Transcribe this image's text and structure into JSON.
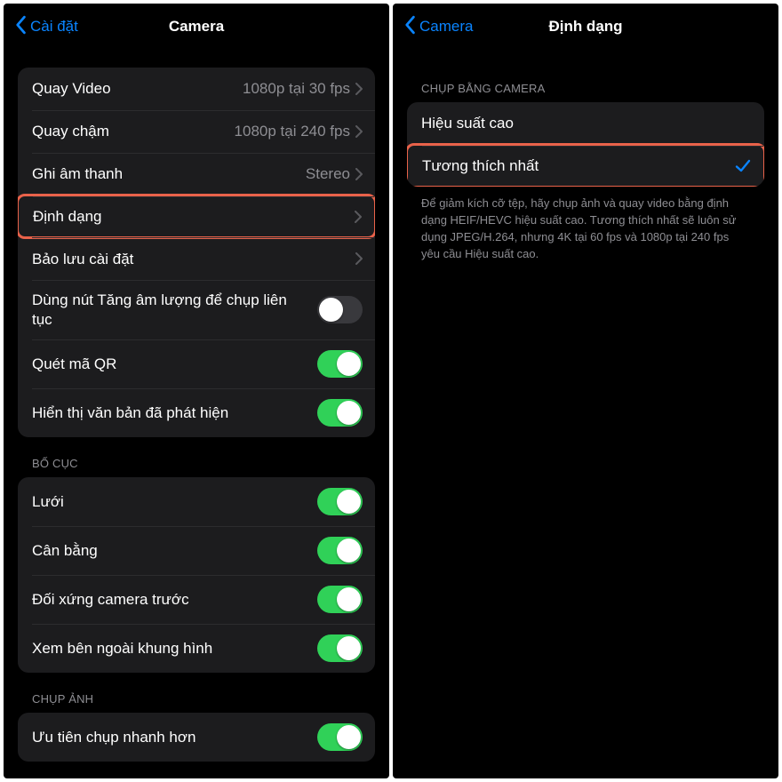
{
  "left": {
    "nav": {
      "back": "Cài đặt",
      "title": "Camera"
    },
    "group1": {
      "row0": {
        "label": "Quay Video",
        "value": "1080p tại 30 fps"
      },
      "row1": {
        "label": "Quay chậm",
        "value": "1080p tại 240 fps"
      },
      "row2": {
        "label": "Ghi âm thanh",
        "value": "Stereo"
      },
      "row3": {
        "label": "Định dạng"
      },
      "row4": {
        "label": "Bảo lưu cài đặt"
      },
      "row5": {
        "label": "Dùng nút Tăng âm lượng để chụp liên tục"
      },
      "row6": {
        "label": "Quét mã QR"
      },
      "row7": {
        "label": "Hiển thị văn bản đã phát hiện"
      }
    },
    "section2": "BỐ CỤC",
    "group2": {
      "row0": {
        "label": "Lưới"
      },
      "row1": {
        "label": "Cân bằng"
      },
      "row2": {
        "label": "Đối xứng camera trước"
      },
      "row3": {
        "label": "Xem bên ngoài khung hình"
      }
    },
    "section3": "CHỤP ẢNH",
    "group3": {
      "row0": {
        "label": "Ưu tiên chụp nhanh hơn"
      }
    }
  },
  "right": {
    "nav": {
      "back": "Camera",
      "title": "Định dạng"
    },
    "section1": "CHỤP BẰNG CAMERA",
    "group1": {
      "row0": {
        "label": "Hiệu suất cao"
      },
      "row1": {
        "label": "Tương thích nhất"
      }
    },
    "footer": "Để giảm kích cỡ tệp, hãy chụp ảnh và quay video bằng định dạng HEIF/HEVC hiệu suất cao. Tương thích nhất sẽ luôn sử dụng JPEG/H.264, nhưng 4K tại 60 fps và 1080p tại 240 fps yêu cầu Hiệu suất cao."
  }
}
